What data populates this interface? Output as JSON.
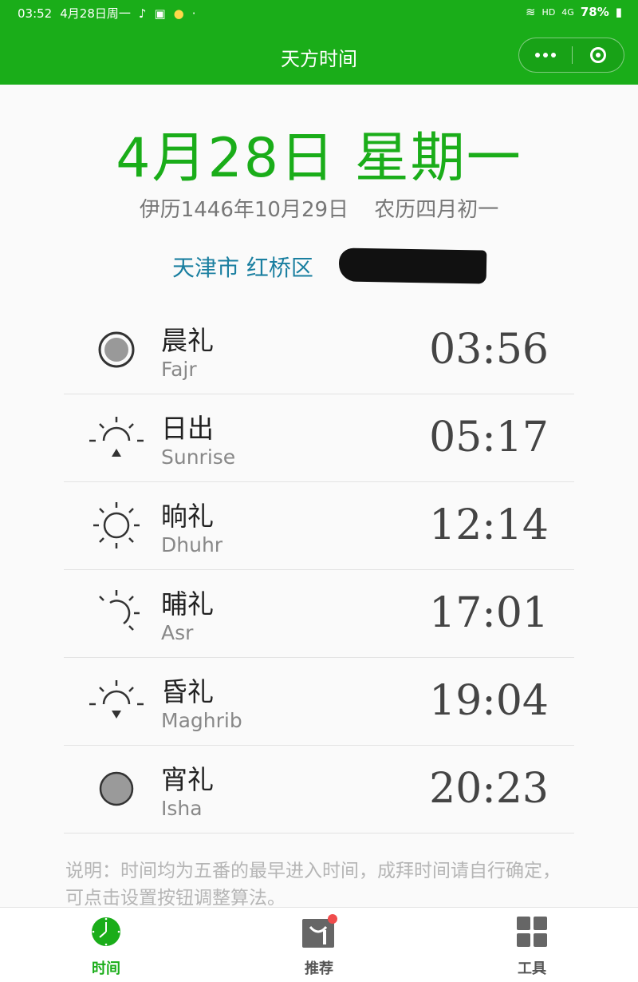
{
  "status_bar": {
    "time": "03:52",
    "date": "4月28日周一",
    "network": "HD",
    "signal": "4G",
    "battery": "78%"
  },
  "nav": {
    "title": "天方时间",
    "more_icon": "more-dots-icon",
    "close_icon": "target-circle-icon"
  },
  "header": {
    "date_main": "4月28日 星期一",
    "hijri_date": "伊历1446年10月29日",
    "lunar_date": "农历四月初一",
    "location": "天津市 红桥区"
  },
  "prayers": [
    {
      "name_zh": "晨礼",
      "name_en": "Fajr",
      "time": "03:56",
      "icon": "filled-ring-icon"
    },
    {
      "name_zh": "日出",
      "name_en": "Sunrise",
      "time": "05:17",
      "icon": "sunrise-icon"
    },
    {
      "name_zh": "晌礼",
      "name_en": "Dhuhr",
      "time": "12:14",
      "icon": "sun-icon"
    },
    {
      "name_zh": "晡礼",
      "name_en": "Asr",
      "time": "17:01",
      "icon": "afternoon-sun-icon"
    },
    {
      "name_zh": "昏礼",
      "name_en": "Maghrib",
      "time": "19:04",
      "icon": "sunset-icon"
    },
    {
      "name_zh": "宵礼",
      "name_en": "Isha",
      "time": "20:23",
      "icon": "gray-circle-icon"
    }
  ],
  "note": "说明：时间均为五番的最早进入时间，成拜时间请自行确定，可点击设置按钮调整算法。",
  "tabs": [
    {
      "label": "时间",
      "icon": "clock-icon",
      "active": true
    },
    {
      "label": "推荐",
      "icon": "shopping-bag-icon",
      "active": false
    },
    {
      "label": "工具",
      "icon": "grid-icon",
      "active": false
    }
  ],
  "colors": {
    "brand_green": "#1aad19",
    "location_blue": "#1a7fa0",
    "badge_red": "#f04c4c"
  }
}
